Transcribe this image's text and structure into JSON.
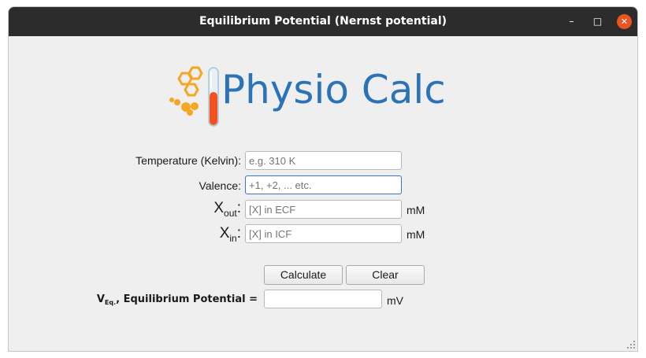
{
  "window": {
    "title": "Equilibrium Potential (Nernst potential)",
    "controls": {
      "minimize": "–",
      "maximize": "□",
      "close": "✕"
    }
  },
  "logo": {
    "text": "Physio Calc",
    "icon": "honeycomb-test-tube-icon",
    "color": "#2c72b6",
    "accent": "#f5a623"
  },
  "form": {
    "temperature": {
      "label": "Temperature (Kelvin):",
      "placeholder": "e.g. 310 K"
    },
    "valence": {
      "label": "Valence:",
      "placeholder": "+1, +2, ... etc."
    },
    "xout": {
      "label_main": "X",
      "label_sub": "out",
      "label_colon": ":",
      "placeholder": "[X] in ECF",
      "unit": "mM"
    },
    "xin": {
      "label_main": "X",
      "label_sub": "in",
      "label_colon": ":",
      "placeholder": "[X] in ICF",
      "unit": "mM"
    }
  },
  "buttons": {
    "calculate": "Calculate",
    "clear": "Clear"
  },
  "result": {
    "label_main": "V",
    "label_sub": "Eq.",
    "label_rest": ", Equilibrium Potential =",
    "value": "",
    "unit": "mV"
  }
}
